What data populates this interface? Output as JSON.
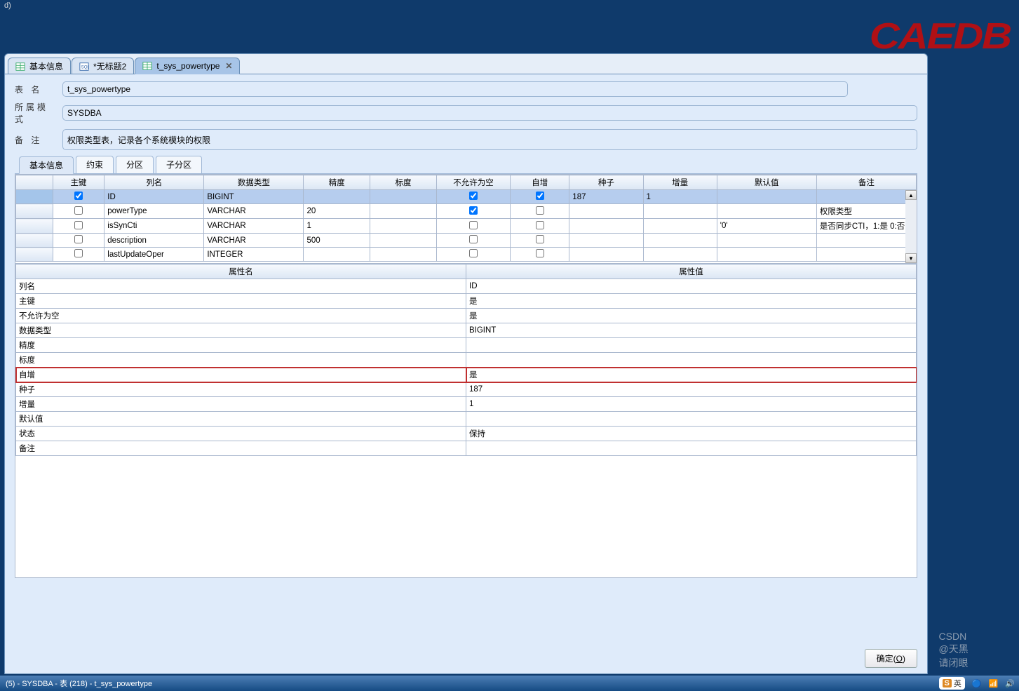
{
  "topbar": {
    "hint": "d)"
  },
  "brand": "CAEDB",
  "tabs": [
    {
      "label": "基本信息",
      "icon": "table"
    },
    {
      "label": "*无标题2",
      "icon": "sql"
    },
    {
      "label": "t_sys_powertype",
      "icon": "table",
      "active": true,
      "closable": true
    }
  ],
  "form": {
    "table_name_label": "表  名",
    "table_name_value": "t_sys_powertype",
    "schema_label": "所属模式",
    "schema_value": "SYSDBA",
    "remark_label": "备  注",
    "remark_value": "权限类型表，记录各个系统模块的权限"
  },
  "subtabs": [
    {
      "label": "基本信息",
      "active": true
    },
    {
      "label": "约束"
    },
    {
      "label": "分区"
    },
    {
      "label": "子分区"
    }
  ],
  "grid": {
    "headers": [
      "",
      "主键",
      "列名",
      "数据类型",
      "精度",
      "标度",
      "不允许为空",
      "自增",
      "种子",
      "增量",
      "默认值",
      "备注"
    ],
    "rows": [
      {
        "selected": true,
        "pk": true,
        "name": "ID",
        "type": "BIGINT",
        "precision": "",
        "scale": "",
        "notnull": true,
        "auto": true,
        "seed": "187",
        "incr": "1",
        "default": "",
        "remark": ""
      },
      {
        "pk": false,
        "name": "powerType",
        "type": "VARCHAR",
        "precision": "20",
        "scale": "",
        "notnull": true,
        "auto": false,
        "seed": "",
        "incr": "",
        "default": "",
        "remark": "权限类型"
      },
      {
        "pk": false,
        "name": "isSynCti",
        "type": "VARCHAR",
        "precision": "1",
        "scale": "",
        "notnull": false,
        "auto": false,
        "seed": "",
        "incr": "",
        "default": "'0'",
        "remark": "是否同步CTI，1:是 0:否"
      },
      {
        "pk": false,
        "name": "description",
        "type": "VARCHAR",
        "precision": "500",
        "scale": "",
        "notnull": false,
        "auto": false,
        "seed": "",
        "incr": "",
        "default": "",
        "remark": ""
      },
      {
        "pk": false,
        "name": "lastUpdateOper",
        "type": "INTEGER",
        "precision": "",
        "scale": "",
        "notnull": false,
        "auto": false,
        "seed": "",
        "incr": "",
        "default": "",
        "remark": ""
      }
    ]
  },
  "properties": {
    "headers": [
      "属性名",
      "属性值"
    ],
    "rows": [
      {
        "name": "列名",
        "value": "ID"
      },
      {
        "name": "主键",
        "value": "是"
      },
      {
        "name": "不允许为空",
        "value": "是"
      },
      {
        "name": "数据类型",
        "value": "BIGINT"
      },
      {
        "name": "精度",
        "value": ""
      },
      {
        "name": "标度",
        "value": ""
      },
      {
        "name": "自增",
        "value": "是",
        "highlight": true
      },
      {
        "name": "种子",
        "value": "187"
      },
      {
        "name": "增量",
        "value": "1"
      },
      {
        "name": "默认值",
        "value": ""
      },
      {
        "name": "状态",
        "value": "保持"
      },
      {
        "name": "备注",
        "value": ""
      }
    ]
  },
  "footer": {
    "ok_label": "确定(",
    "ok_key": "O",
    "ok_suffix": ")"
  },
  "statusbar": "(5) -  SYSDBA - 表 (218) -  t_sys_powertype",
  "tray": {
    "ime_s": "S",
    "ime_lang": "英",
    "watermark": "CSDN @天黑请闭眼"
  }
}
